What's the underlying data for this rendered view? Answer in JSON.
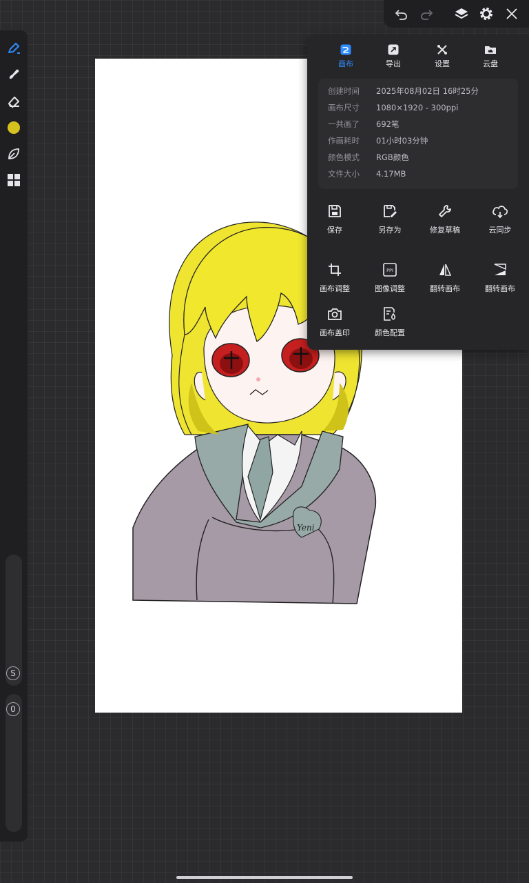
{
  "toolbar": {
    "tools": [
      {
        "name": "brush",
        "icon": "pen-icon"
      },
      {
        "name": "smudge",
        "icon": "smudge-icon"
      },
      {
        "name": "eraser",
        "icon": "eraser-icon"
      },
      {
        "name": "color",
        "icon": "color-swatch-icon"
      },
      {
        "name": "leaf",
        "icon": "leaf-icon"
      },
      {
        "name": "more",
        "icon": "grid-icon"
      }
    ],
    "active_color": "#d6c21f",
    "size_label": "S",
    "opacity_label": "0"
  },
  "top_bar": {
    "icons": [
      "undo-icon",
      "redo-icon",
      "layers-icon",
      "settings-icon",
      "close-icon"
    ]
  },
  "panel": {
    "tabs": [
      {
        "label": "画布",
        "icon": "canvas-icon",
        "active": true
      },
      {
        "label": "导出",
        "icon": "export-icon",
        "active": false
      },
      {
        "label": "设置",
        "icon": "tools-icon",
        "active": false
      },
      {
        "label": "云盘",
        "icon": "cloud-drive-icon",
        "active": false
      }
    ],
    "info": [
      {
        "key": "创建时间",
        "value": "2025年08月02日 16时25分"
      },
      {
        "key": "画布尺寸",
        "value": "1080×1920 - 300ppi"
      },
      {
        "key": "一共画了",
        "value": "692笔"
      },
      {
        "key": "作画耗时",
        "value": "01小时03分钟"
      },
      {
        "key": "颜色模式",
        "value": "RGB颜色"
      },
      {
        "key": "文件大小",
        "value": "4.17MB"
      }
    ],
    "actions": [
      {
        "label": "保存",
        "icon": "save-icon"
      },
      {
        "label": "另存为",
        "icon": "save-as-icon"
      },
      {
        "label": "修复草稿",
        "icon": "repair-icon"
      },
      {
        "label": "云同步",
        "icon": "cloud-sync-icon"
      },
      {
        "label": "画布调整",
        "icon": "crop-icon"
      },
      {
        "label": "图像调整",
        "icon": "ppi-icon"
      },
      {
        "label": "翻转画布",
        "icon": "flip-horizontal-icon"
      },
      {
        "label": "翻转画布",
        "icon": "flip-vertical-icon"
      },
      {
        "label": "画布盖印",
        "icon": "camera-icon"
      },
      {
        "label": "颜色配置",
        "icon": "color-profile-icon"
      }
    ]
  },
  "colors": {
    "accent": "#2f8cff",
    "panel_bg": "#262628",
    "canvas_bg": "#ffffff"
  }
}
